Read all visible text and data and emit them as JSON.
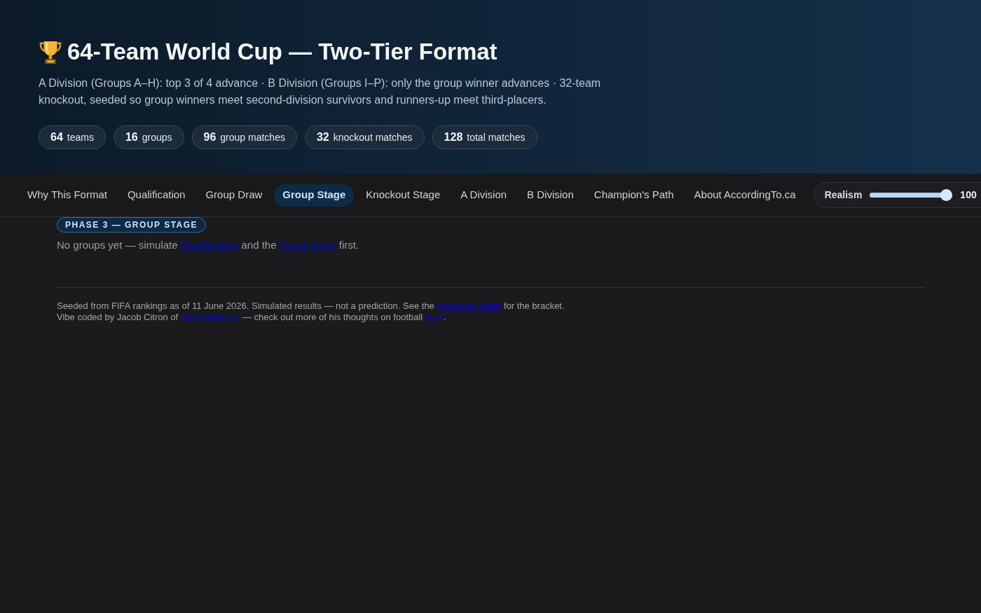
{
  "header": {
    "title": "64-Team World Cup — Two-Tier Format",
    "description": "A Division (Groups A–H): top 3 of 4 advance · B Division (Groups I–P): only the group winner advances · 32-team knockout, seeded so group winners meet second-division survivors and runners-up meet third-placers.",
    "stats": [
      {
        "value": "64",
        "label": "teams"
      },
      {
        "value": "16",
        "label": "groups"
      },
      {
        "value": "96",
        "label": "group matches"
      },
      {
        "value": "32",
        "label": "knockout matches"
      },
      {
        "value": "128",
        "label": "total matches"
      }
    ]
  },
  "nav": {
    "tabs": [
      {
        "label": "Why This Format",
        "selected": false
      },
      {
        "label": "Qualification",
        "selected": false
      },
      {
        "label": "Group Draw",
        "selected": false
      },
      {
        "label": "Group Stage",
        "selected": true
      },
      {
        "label": "Knockout Stage",
        "selected": false
      },
      {
        "label": "A Division",
        "selected": false
      },
      {
        "label": "B Division",
        "selected": false
      },
      {
        "label": "Champion's Path",
        "selected": false
      },
      {
        "label": "About AccordingTo.ca",
        "selected": false
      }
    ],
    "realism": {
      "label": "Realism",
      "level": 1,
      "reading": "100"
    }
  },
  "phase_badge": "PHASE 3 — GROUP STAGE",
  "empty_message": [
    {
      "kind": "text",
      "text": "No groups yet — simulate "
    },
    {
      "kind": "link",
      "text": "Qualification"
    },
    {
      "kind": "text",
      "text": " and the "
    },
    {
      "kind": "link",
      "text": "Group Draw"
    },
    {
      "kind": "text",
      "text": " first."
    }
  ],
  "footer": [
    [
      {
        "kind": "text",
        "text": "Seeded from FIFA rankings as of 11 June 2026. Simulated results — not a prediction. See the "
      },
      {
        "kind": "link",
        "text": "Knockout Stage"
      },
      {
        "kind": "text",
        "text": " for the bracket."
      }
    ],
    [
      {
        "kind": "text",
        "text": "Vibe coded by Jacob Citron of "
      },
      {
        "kind": "link",
        "text": "accordingto.ca"
      },
      {
        "kind": "text",
        "text": " — check out more of his thoughts on football "
      },
      {
        "kind": "link",
        "text": "here"
      },
      {
        "kind": "text",
        "text": "."
      }
    ]
  ]
}
